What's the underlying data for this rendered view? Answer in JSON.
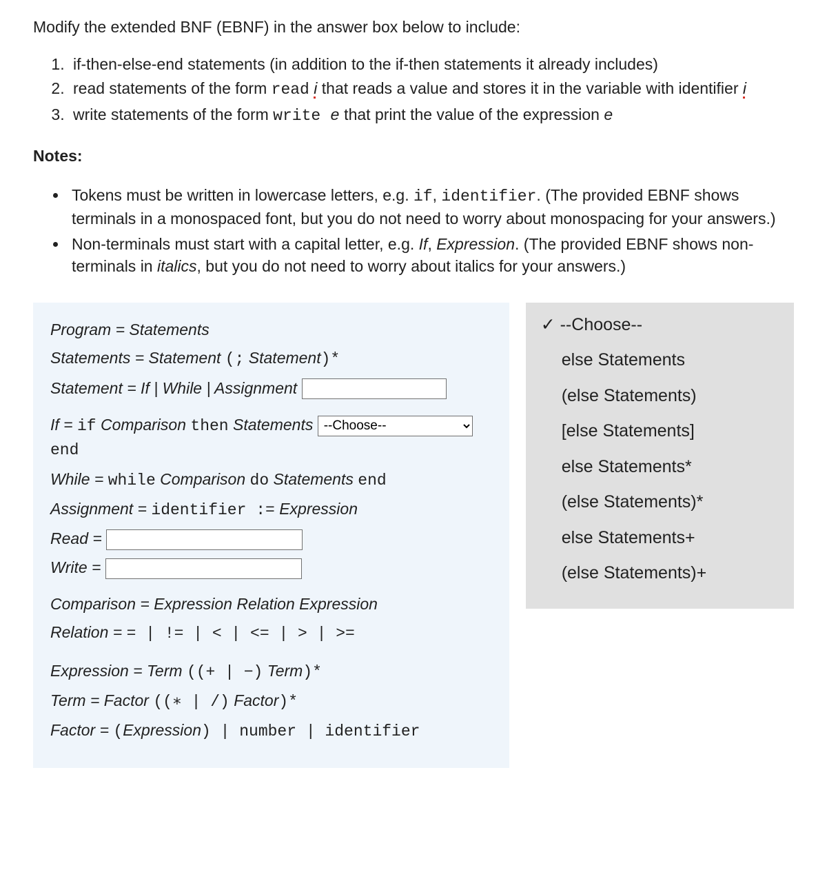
{
  "intro": "Modify the extended BNF (EBNF) in the answer box below to include:",
  "list": {
    "i1_a": "if-then-else-end statements (in addition to the if-then statements it already includes)",
    "i2_a": "read statements of the form ",
    "i2_read": "read",
    "i2_b": " that reads a value and stores it in the variable with identifier ",
    "i2_i": "i",
    "i3_a": "write statements of the form ",
    "i3_write": "write",
    "i3_b": " that print the value of the expression ",
    "i3_e": "e",
    "i3_e_mono": " e"
  },
  "notes_h": "Notes:",
  "notes": {
    "n1_a": "Tokens must be written in lowercase letters, e.g. ",
    "n1_tok1": "if",
    "n1_mid": ", ",
    "n1_tok2": "identifier",
    "n1_b": ". (The provided EBNF shows terminals in a monospaced font, but you do not need to worry about monospacing for your answers.)",
    "n2_a": "Non-terminals must start with a capital letter, e.g. ",
    "n2_nt1": "If",
    "n2_mid": ", ",
    "n2_nt2": "Expression",
    "n2_b": ". (The provided EBNF shows non-terminals in ",
    "n2_it": "italics",
    "n2_c": ", but you do not need to worry about italics for your answers.)"
  },
  "ebnf": {
    "l1": "Program = Statements",
    "l2_a": "Statements = Statement ",
    "l2_b": "(;",
    "l2_c": " Statement",
    "l2_d": ")*",
    "l3": "Statement = If | While | Assignment ",
    "l4_a": "If = ",
    "l4_if": "if",
    "l4_b": " Comparison ",
    "l4_then": "then",
    "l4_c": " Statements ",
    "l4_end": " end",
    "l5_a": "While = ",
    "l5_while": "while",
    "l5_b": " Comparison ",
    "l5_do": "do",
    "l5_c": " Statements ",
    "l5_end": "end",
    "l6_a": "Assignment = ",
    "l6_id": "identifier :=",
    "l6_b": " Expression",
    "l7": "Read = ",
    "l8": "Write = ",
    "l9": "Comparison = Expression Relation Expression",
    "l10_a": "Relation = ",
    "l10_b": "= | != | < | <= | > | >=",
    "l11_a": "Expression = Term ",
    "l11_b": "((+ | −)",
    "l11_c": " Term",
    "l11_d": ")*",
    "l12_a": "Term = Factor ",
    "l12_b": "((∗ | /)",
    "l12_c": " Factor",
    "l12_d": ")*",
    "l13_a": "Factor = ",
    "l13_b": "(",
    "l13_c": "Expression",
    "l13_d": ") | number | identifier"
  },
  "inputs": {
    "statement_extra": "",
    "read_def": "",
    "write_def": "",
    "choose_selected": "--Choose--"
  },
  "options": {
    "o0": "--Choose--",
    "o1": "else Statements",
    "o2": "(else Statements)",
    "o3": "[else Statements]",
    "o4": "else Statements*",
    "o5": "(else Statements)*",
    "o6": "else Statements+",
    "o7": "(else Statements)+"
  },
  "check": "✓ "
}
